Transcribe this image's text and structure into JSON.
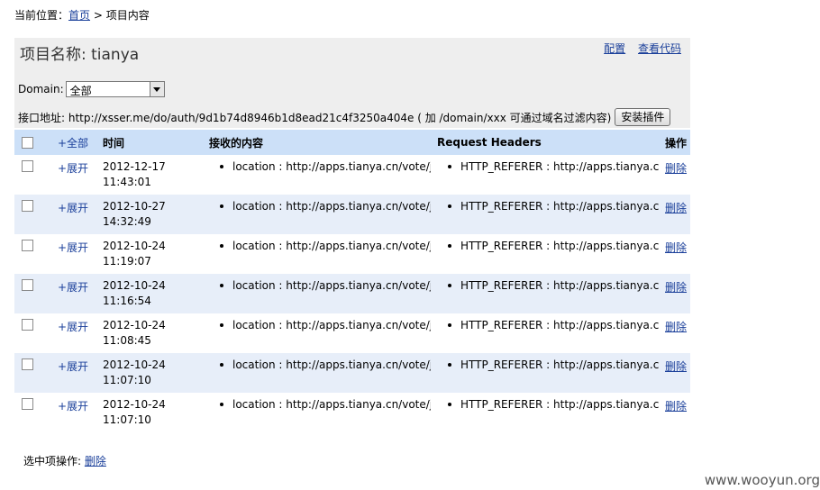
{
  "breadcrumb": {
    "prefix": "当前位置：",
    "home": "首页",
    "sep": " > ",
    "current": "项目内容"
  },
  "project": {
    "title": "项目名称: tianya"
  },
  "links": {
    "config": "配置",
    "view_code": "查看代码"
  },
  "domain": {
    "label": "Domain:",
    "selected": "全部"
  },
  "api": {
    "text": "接口地址: http://xsser.me/do/auth/9d1b74d8946b1d8ead21c4f3250a404e ( 加 /domain/xxx 可通过域名过滤内容)",
    "install_label": "安装插件"
  },
  "table": {
    "headers": {
      "expand_all": "+全部",
      "time": "时间",
      "content": "接收的内容",
      "headers": "Request Headers",
      "ops": "操作"
    },
    "rows": [
      {
        "expand": "+展开",
        "date": "2012-12-17",
        "time": "11:43:01",
        "content": "location : http://apps.tianya.cn/vote/join/vi",
        "header": "HTTP_REFERER : http://apps.tianya.cn/",
        "delete": "删除"
      },
      {
        "expand": "+展开",
        "date": "2012-10-27",
        "time": "14:32:49",
        "content": "location : http://apps.tianya.cn/vote/join/vi",
        "header": "HTTP_REFERER : http://apps.tianya.cn/",
        "delete": "删除"
      },
      {
        "expand": "+展开",
        "date": "2012-10-24",
        "time": "11:19:07",
        "content": "location : http://apps.tianya.cn/vote/join/vi",
        "header": "HTTP_REFERER : http://apps.tianya.cn/",
        "delete": "删除"
      },
      {
        "expand": "+展开",
        "date": "2012-10-24",
        "time": "11:16:54",
        "content": "location : http://apps.tianya.cn/vote/join/vi",
        "header": "HTTP_REFERER : http://apps.tianya.cn/",
        "delete": "删除"
      },
      {
        "expand": "+展开",
        "date": "2012-10-24",
        "time": "11:08:45",
        "content": "location : http://apps.tianya.cn/vote/join/vi",
        "header": "HTTP_REFERER : http://apps.tianya.cn/",
        "delete": "删除"
      },
      {
        "expand": "+展开",
        "date": "2012-10-24",
        "time": "11:07:10",
        "content": "location : http://apps.tianya.cn/vote/join/vi",
        "header": "HTTP_REFERER : http://apps.tianya.cn/",
        "delete": "删除"
      },
      {
        "expand": "+展开",
        "date": "2012-10-24",
        "time": "11:07:10",
        "content": "location : http://apps.tianya.cn/vote/join/vi",
        "header": "HTTP_REFERER : http://apps.tianya.cn/",
        "delete": "删除"
      }
    ]
  },
  "bottom": {
    "label": "选中项操作:",
    "delete": "删除"
  },
  "watermark": "www.wooyun.org"
}
